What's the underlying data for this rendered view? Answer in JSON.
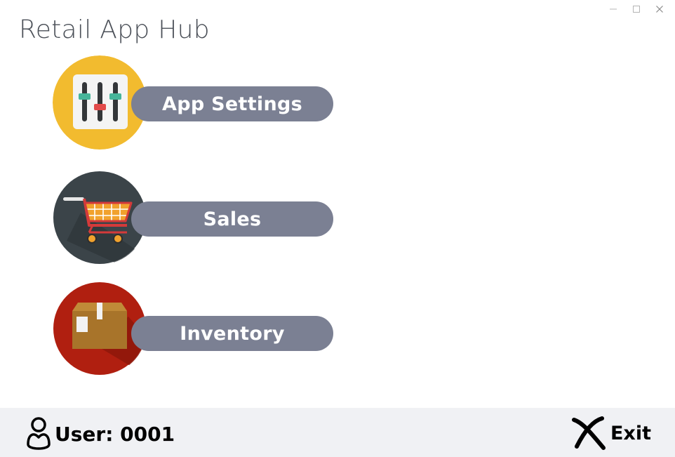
{
  "window": {
    "title": "Retail App Hub",
    "controls": [
      "minimize-icon",
      "maximize-icon",
      "close-icon"
    ]
  },
  "menu": {
    "items": [
      {
        "id": "settings",
        "label": "App Settings",
        "icon": "sliders-icon",
        "color": "#f2bb2f"
      },
      {
        "id": "sales",
        "label": "Sales",
        "icon": "shopping-cart-icon",
        "color": "#3b4449"
      },
      {
        "id": "inventory",
        "label": "Inventory",
        "icon": "box-icon",
        "color": "#b01f10"
      }
    ],
    "pill_color": "#7b8093"
  },
  "footer": {
    "user_label": "User: 0001",
    "user_icon": "user-icon",
    "exit_label": "Exit",
    "exit_icon": "exit-x-icon"
  }
}
